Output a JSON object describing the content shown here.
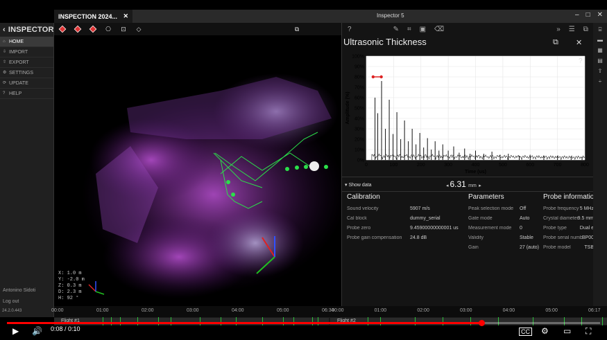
{
  "app": {
    "title": "Inspector 5",
    "tab_label": "INSPECTION 2024...",
    "tab_close": "✕",
    "brand": "INSPECTOR",
    "version": "24.2.0.443"
  },
  "window_controls": [
    "–",
    "□",
    "✕"
  ],
  "sidebar": {
    "items": [
      {
        "label": "HOME",
        "icon": "home-icon",
        "glyph": "⌂"
      },
      {
        "label": "IMPORT",
        "icon": "import-icon",
        "glyph": "⇩"
      },
      {
        "label": "EXPORT",
        "icon": "export-icon",
        "glyph": "⇧"
      },
      {
        "label": "SETTINGS",
        "icon": "gear-icon",
        "glyph": "⚙"
      },
      {
        "label": "UPDATE",
        "icon": "update-icon",
        "glyph": "⟳"
      },
      {
        "label": "HELP",
        "icon": "help-icon",
        "glyph": "?"
      }
    ],
    "user": "Antonino Sidoti",
    "logout": "Log out"
  },
  "viewport": {
    "coords": [
      "X:   1.0 m",
      "Y:  -2.0 m",
      "Z:   0.3 m",
      "D:   2.3 m",
      "H:    92 °"
    ]
  },
  "panel": {
    "title": "Ultrasonic Thickness",
    "help": "?",
    "show_data": "Show data",
    "thickness_value": "6.31",
    "thickness_unit": "mm",
    "calibration": {
      "title": "Calibration",
      "rows": [
        {
          "k": "Sound velocity",
          "v": "5907 m/s"
        },
        {
          "k": "Cal block",
          "v": "dummy_serial"
        },
        {
          "k": "Probe zero",
          "v": "9.45900000000001 us"
        },
        {
          "k": "Probe gain compensation",
          "v": "24.8 dB"
        }
      ]
    },
    "parameters": {
      "title": "Parameters",
      "rows": [
        {
          "k": "Peak selection mode",
          "v": "Off"
        },
        {
          "k": "Gate mode",
          "v": "Auto"
        },
        {
          "k": "Measurement mode",
          "v": "0"
        },
        {
          "k": "Validity",
          "v": "Stable"
        },
        {
          "k": "Gain",
          "v": "27 (auto)"
        }
      ]
    },
    "probe": {
      "title": "Probe information",
      "rows": [
        {
          "k": "Probe frequency",
          "v": "5 MHz"
        },
        {
          "k": "Crystal diameter",
          "v": "9.5 mm"
        },
        {
          "k": "Probe type",
          "v": "Dual e"
        },
        {
          "k": "Probe serial number",
          "v": "BP00"
        },
        {
          "k": "Probe model",
          "v": "TSB"
        }
      ]
    }
  },
  "chart_data": {
    "type": "line",
    "xlabel": "Time (us)",
    "ylabel": "Amplitude (%)",
    "x_ticks": [
      0,
      100,
      200,
      300,
      400,
      500,
      600,
      700,
      800
    ],
    "y_ticks": [
      "0%",
      "10%",
      "20%",
      "30%",
      "40%",
      "50%",
      "60%",
      "70%",
      "80%",
      "90%",
      "100%"
    ],
    "xlim": [
      0,
      800
    ],
    "ylim": [
      0,
      100
    ],
    "gate_level": 80,
    "gate_range": [
      25,
      55
    ],
    "peaks": [
      {
        "x": 32,
        "y": 60
      },
      {
        "x": 42,
        "y": 45
      },
      {
        "x": 56,
        "y": 76
      },
      {
        "x": 70,
        "y": 30
      },
      {
        "x": 84,
        "y": 58
      },
      {
        "x": 98,
        "y": 25
      },
      {
        "x": 112,
        "y": 46
      },
      {
        "x": 126,
        "y": 20
      },
      {
        "x": 140,
        "y": 38
      },
      {
        "x": 154,
        "y": 18
      },
      {
        "x": 168,
        "y": 30
      },
      {
        "x": 182,
        "y": 15
      },
      {
        "x": 196,
        "y": 26
      },
      {
        "x": 210,
        "y": 12
      },
      {
        "x": 224,
        "y": 21
      },
      {
        "x": 238,
        "y": 10
      },
      {
        "x": 252,
        "y": 18
      },
      {
        "x": 266,
        "y": 9
      },
      {
        "x": 280,
        "y": 15
      },
      {
        "x": 300,
        "y": 9
      },
      {
        "x": 320,
        "y": 13
      },
      {
        "x": 340,
        "y": 7
      },
      {
        "x": 360,
        "y": 11
      },
      {
        "x": 380,
        "y": 6
      },
      {
        "x": 400,
        "y": 9
      },
      {
        "x": 430,
        "y": 6
      },
      {
        "x": 460,
        "y": 8
      },
      {
        "x": 490,
        "y": 5
      },
      {
        "x": 520,
        "y": 6
      },
      {
        "x": 560,
        "y": 4
      },
      {
        "x": 600,
        "y": 5
      },
      {
        "x": 650,
        "y": 4
      },
      {
        "x": 700,
        "y": 4
      },
      {
        "x": 750,
        "y": 3
      },
      {
        "x": 790,
        "y": 3
      }
    ]
  },
  "timeline": {
    "ticks_a": [
      "00:00",
      "01:00",
      "02:00",
      "03:00",
      "04:00",
      "05:00",
      "06:34"
    ],
    "ticks_b": [
      "00:00",
      "01:00",
      "02:00",
      "03:00",
      "04:00",
      "05:00",
      "06:17"
    ],
    "flight_a": "Flight #1",
    "flight_b": "Flight #2"
  },
  "player": {
    "time": "0:08 / 0:10",
    "progress": 0.8
  }
}
